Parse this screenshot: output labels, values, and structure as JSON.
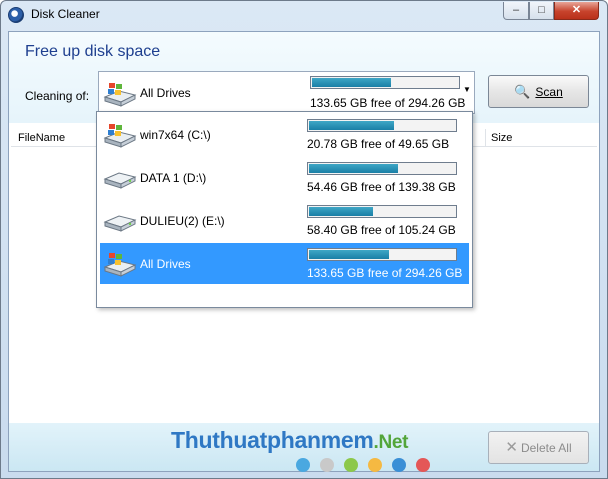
{
  "window": {
    "title": "Disk Cleaner"
  },
  "header": {
    "title": "Free up disk space",
    "cleaning_label": "Cleaning of:"
  },
  "combo": {
    "selected_name": "All Drives",
    "selected_free": "133.65 GB free of 294.26 GB",
    "selected_used_fraction": 0.54
  },
  "scan_button": {
    "label": "Scan"
  },
  "list": {
    "col_filename": "FileName",
    "col_size": "Size"
  },
  "drives": [
    {
      "name": "win7x64 (C:\\)",
      "free": "20.78 GB free of 49.65 GB",
      "used_fraction": 0.58,
      "icon": "windows-drive-icon"
    },
    {
      "name": "DATA 1 (D:\\)",
      "free": "54.46 GB free of 139.38 GB",
      "used_fraction": 0.61,
      "icon": "hard-drive-icon"
    },
    {
      "name": "DULIEU(2) (E:\\)",
      "free": "58.40 GB free of 105.24 GB",
      "used_fraction": 0.44,
      "icon": "hard-drive-icon"
    },
    {
      "name": "All Drives",
      "free": "133.65 GB free of 294.26 GB",
      "used_fraction": 0.55,
      "icon": "windows-drive-icon",
      "selected": true
    }
  ],
  "footer": {
    "watermark_main": "Thuthuatphanmem",
    "watermark_suffix": ".Net",
    "delete_label": "Delete All",
    "dot_colors": [
      "#4aa8e0",
      "#c9c9c9",
      "#8cc84b",
      "#f5b942",
      "#3a8fd6",
      "#e45757"
    ]
  },
  "colors": {
    "accent": "#3399ff",
    "bar": "#1a7fa6",
    "title": "#1e3f8f"
  }
}
